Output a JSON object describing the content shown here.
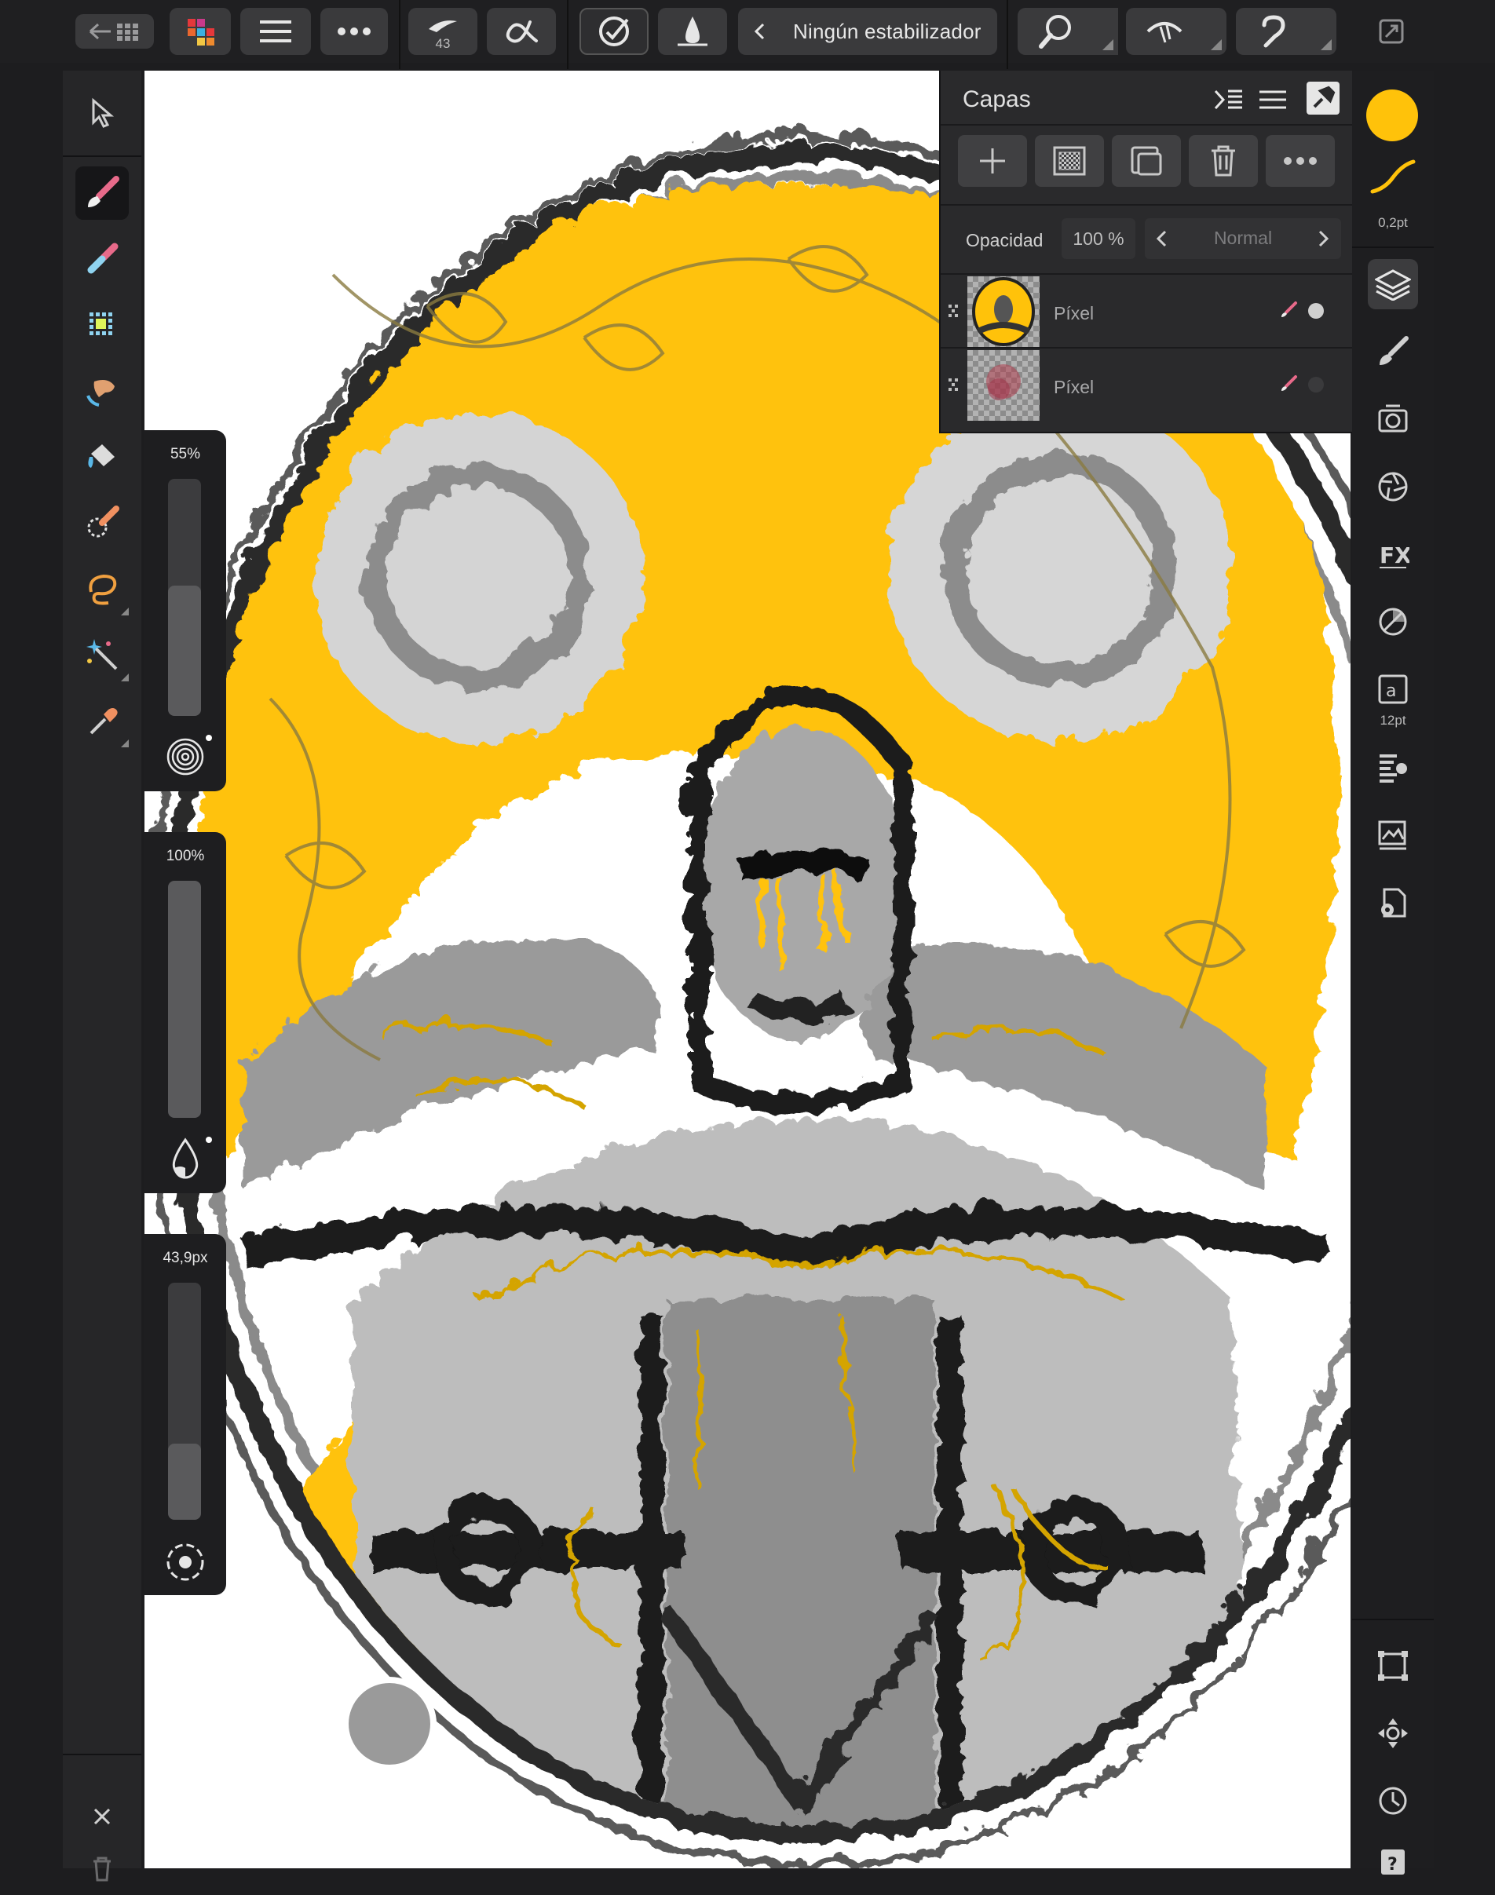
{
  "toolbar": {
    "stabilizer_label": "Ningún estabilizador",
    "brush_size": "43"
  },
  "layers_panel": {
    "title": "Capas",
    "opacity_label": "Opacidad",
    "opacity_value": "100 %",
    "blend_mode": "Normal",
    "layers": [
      {
        "name": "Píxel",
        "visible": true
      },
      {
        "name": "Píxel",
        "visible": false
      }
    ]
  },
  "sliders": {
    "size": {
      "label": "55%",
      "value": 0.55
    },
    "opacity": {
      "label": "100%",
      "value": 1.0
    },
    "flow": {
      "label": "43,9px",
      "value": 0.32
    }
  },
  "right_bar": {
    "stroke_width": "0,2pt",
    "text_size": "12pt",
    "accent_color": "#ffc20a"
  },
  "colors": {
    "primary": "#ffc20a",
    "ui_dark": "#1e1e20",
    "ui_button": "#3a3a3c"
  }
}
